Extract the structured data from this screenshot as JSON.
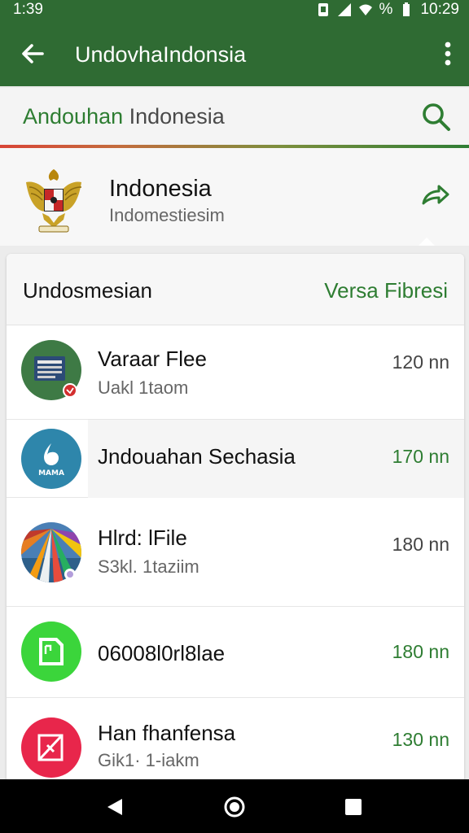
{
  "status_bar": {
    "time": "1:39",
    "right_time": "10:29",
    "battery_label": "%"
  },
  "app_bar": {
    "title": "UndovhaIndonsia",
    "back_icon": "arrow-left-icon",
    "menu_icon": "more-vert-icon"
  },
  "search": {
    "accent_text": "Andouhan",
    "rest_text": " Indonesia",
    "icon": "search-icon"
  },
  "country": {
    "name": "Indonesia",
    "subtitle": "Indomestiesim",
    "emblem_icon": "garuda-emblem-icon",
    "share_icon": "share-icon"
  },
  "list": {
    "header_title": "Undosmesian",
    "header_action": "Versa Fibresi",
    "items": [
      {
        "title": "Varaar Flee",
        "subtitle": "Uakl 1taom",
        "size": "120 nn",
        "size_color": "grey",
        "icon": "document-icon"
      },
      {
        "title": "Jndouahan Sechasia",
        "subtitle": "",
        "size": "170 nn",
        "size_color": "green",
        "icon": "app-logo-icon"
      },
      {
        "title": "Hlrd: lFile",
        "subtitle": "S3kl. 1taziim",
        "size": "180 nn",
        "size_color": "grey",
        "icon": "image-thumbnail-icon"
      },
      {
        "title": "06008l0rl8lae",
        "subtitle": "",
        "size": "180 nn",
        "size_color": "green",
        "icon": "file-icon"
      },
      {
        "title": "Han fhanfensa",
        "subtitle": "Gik1· 1-iakm",
        "size": "130 nn",
        "size_color": "green",
        "icon": "blocked-file-icon"
      }
    ]
  },
  "colors": {
    "app_bar": "#2f6b33",
    "accent_green": "#2e7d32",
    "underline_red": "#d84436"
  },
  "nav": {
    "back": "nav-back-icon",
    "home": "nav-home-icon",
    "recents": "nav-recents-icon"
  }
}
